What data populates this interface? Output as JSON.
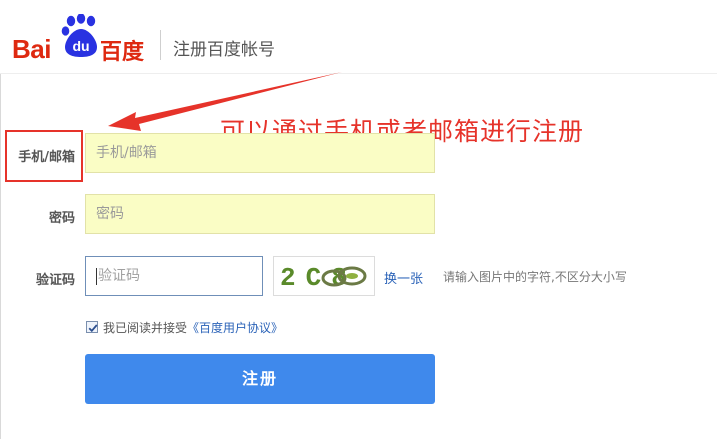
{
  "header": {
    "logo_text_latin": "Bai",
    "logo_text_du": "du",
    "logo_text_cn": "百度",
    "title": "注册百度帐号"
  },
  "annotation": {
    "text": "可以通过手机或者邮箱进行注册"
  },
  "form": {
    "phone_email": {
      "label": "手机/邮箱",
      "placeholder": "手机/邮箱"
    },
    "password": {
      "label": "密码",
      "placeholder": "密码"
    },
    "captcha": {
      "label": "验证码",
      "placeholder": "验证码",
      "image_text": "2C8",
      "refresh_label": "换一张",
      "hint": "请输入图片中的字符,不区分大小写"
    },
    "agreement": {
      "checked": true,
      "text": "我已阅读并接受",
      "link": "《百度用户协议》"
    },
    "submit_label": "注册"
  },
  "colors": {
    "brand_red": "#de2910",
    "brand_blue": "#2932e1",
    "button_blue": "#3f89ec",
    "annotation_red": "#e6332a",
    "input_yellow": "#fafdc5",
    "link_blue": "#2b63b8"
  },
  "icons": {
    "logo_mark": "paw-icon",
    "checkbox": "checkmark-icon"
  }
}
